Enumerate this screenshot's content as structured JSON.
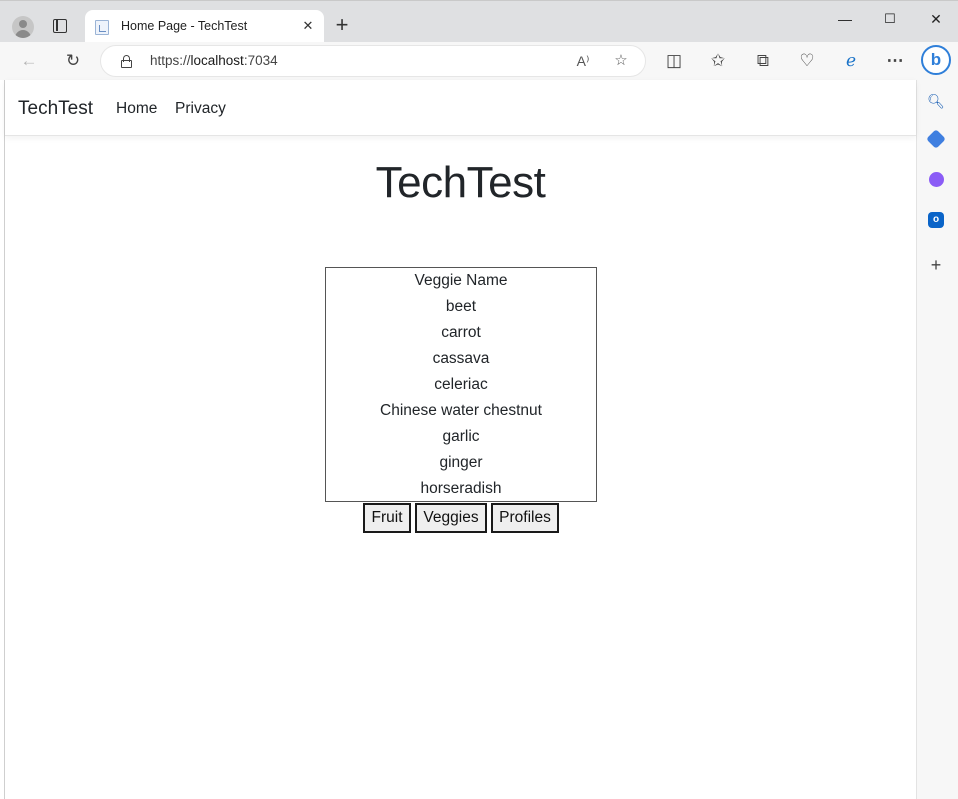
{
  "browser": {
    "tab_title": "Home Page - TechTest",
    "tab_close_glyph": "✕",
    "new_tab_glyph": "+",
    "window_controls": {
      "minimize": "—",
      "maximize": "☐",
      "close": "✕"
    },
    "url_scheme": "https://",
    "url_host": "localhost",
    "url_port": ":7034",
    "read_aloud_glyph": "A⁾",
    "sidebar_brand_glyph": "b"
  },
  "navbar": {
    "brand": "TechTest",
    "links": [
      {
        "label": "Home"
      },
      {
        "label": "Privacy"
      }
    ]
  },
  "main": {
    "heading": "TechTest",
    "list": {
      "header": "Veggie Name",
      "items": [
        "beet",
        "carrot",
        "cassava",
        "celeriac",
        "Chinese water chestnut",
        "garlic",
        "ginger",
        "horseradish"
      ]
    },
    "buttons": [
      {
        "label": "Fruit"
      },
      {
        "label": "Veggies"
      },
      {
        "label": "Profiles"
      }
    ]
  },
  "icons": {
    "toolbar": [
      "back-arrow-icon",
      "refresh-icon",
      "lock-icon",
      "read-aloud-icon",
      "favorite-star-icon",
      "split-screen-icon",
      "favorites-icon",
      "collections-icon",
      "browser-essentials-icon",
      "edge-apps-icon",
      "more-icon"
    ],
    "sidebar": [
      "bing-icon",
      "search-icon",
      "shopping-tag-icon",
      "office-icon",
      "outlook-icon",
      "add-icon"
    ]
  },
  "colors": {
    "tabstrip_bg": "#dfe0e2",
    "toolbar_bg": "#f7f7f7",
    "bing_blue": "#2f7fd9",
    "text": "#212529"
  }
}
